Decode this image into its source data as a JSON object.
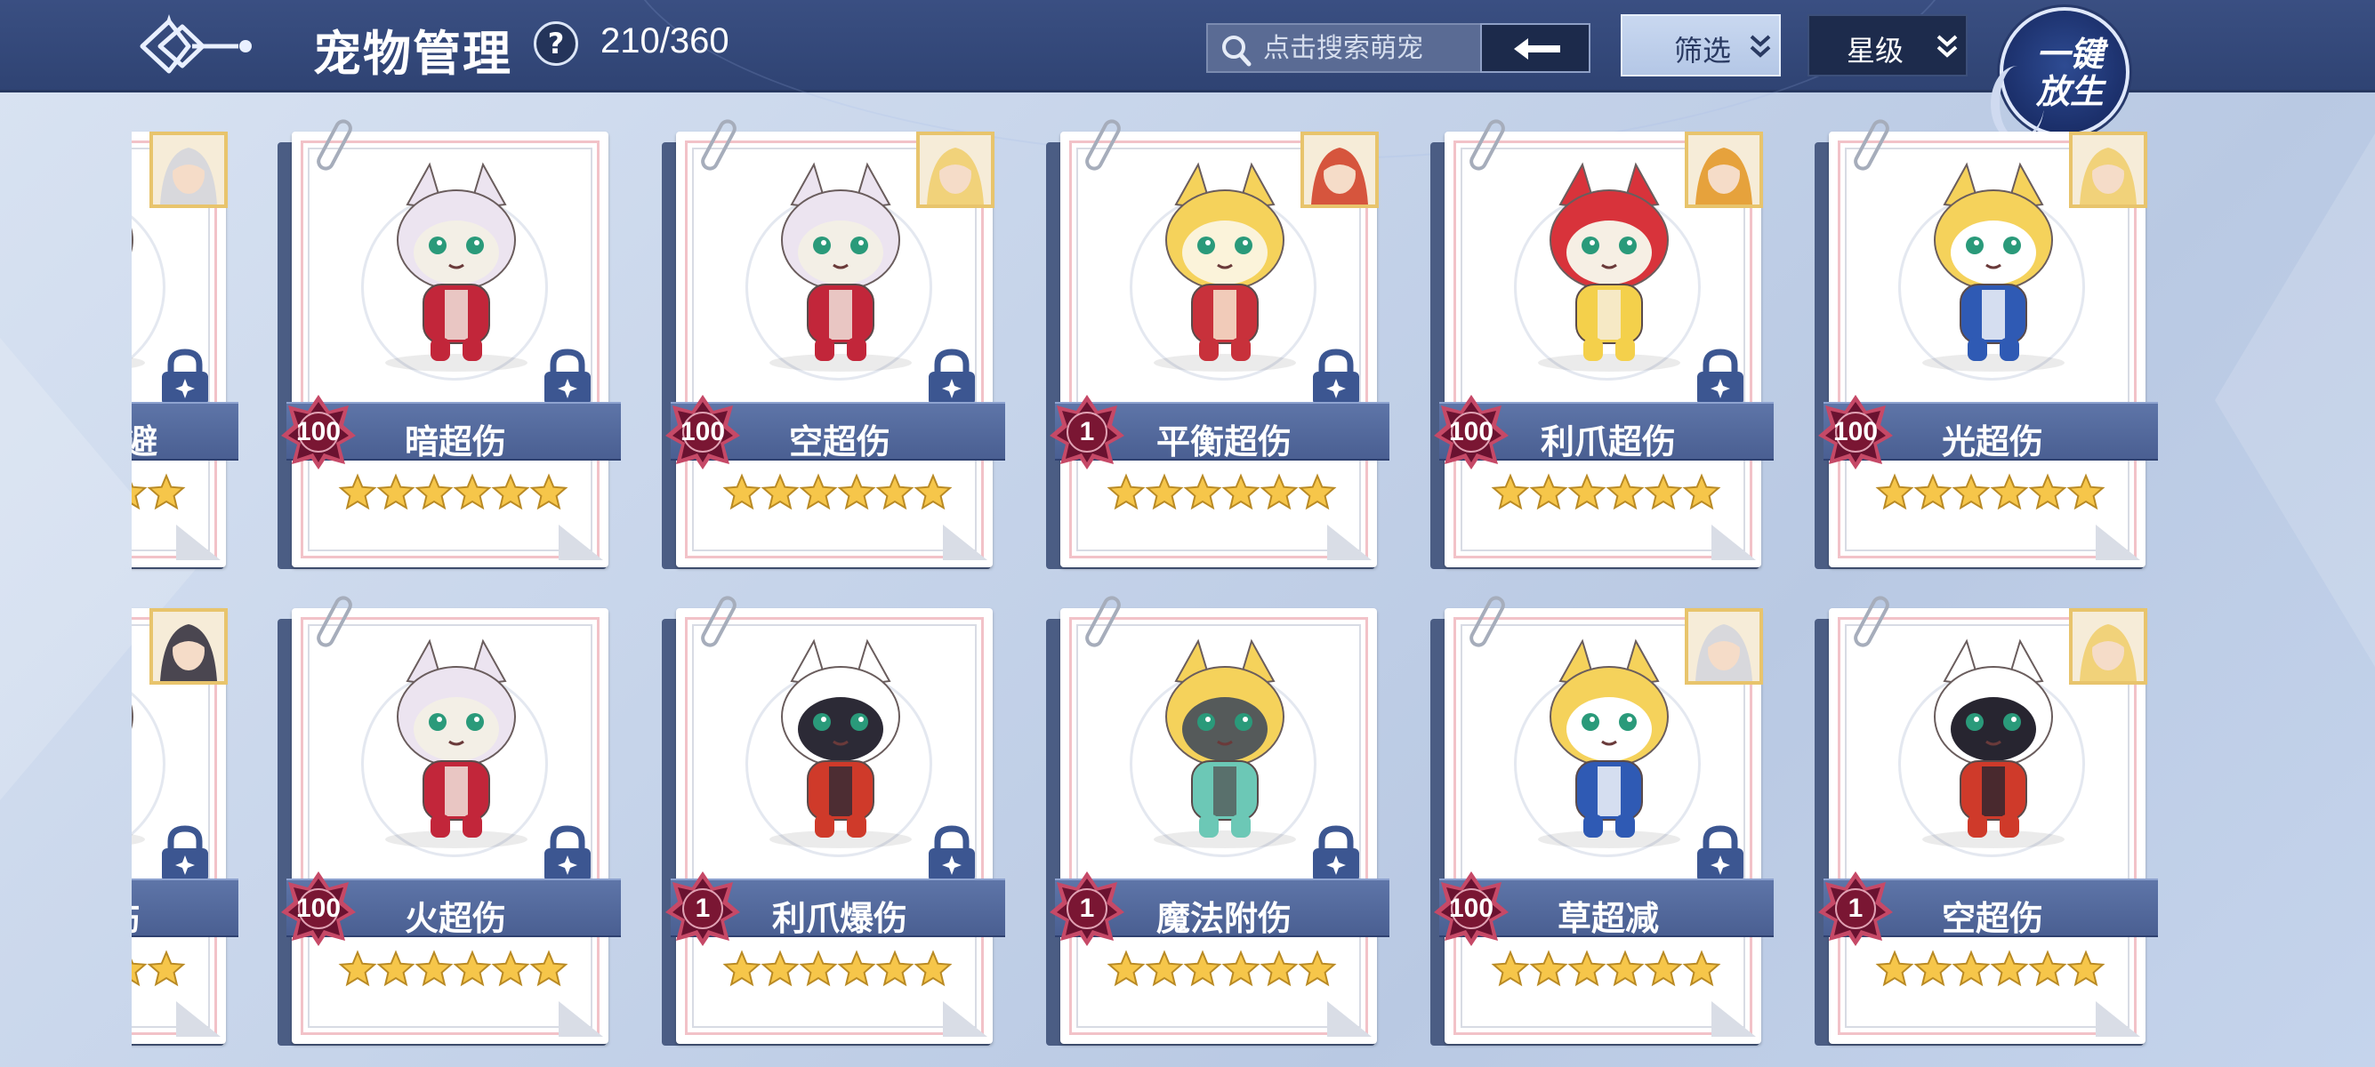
{
  "header": {
    "title": "宠物管理",
    "help": "?",
    "count": "210/360",
    "search_placeholder": "点击搜索萌宠",
    "filter_label": "筛选",
    "star_label": "星级",
    "release_line1": "一键",
    "release_line2": "放生"
  },
  "colors": {
    "header_bg": "#33477a",
    "band": "#5e75a8",
    "level_badge": "#7a1633",
    "star": "#f6c64a",
    "lock": "#3c5691"
  },
  "pets": [
    {
      "name": "大天使闪避",
      "level": "",
      "stars": 6,
      "locked": true,
      "portrait": true,
      "sprite": "green-dino",
      "portrait_theme": "silver"
    },
    {
      "name": "暗超伤",
      "level": "100",
      "stars": 6,
      "locked": true,
      "portrait": false,
      "sprite": "white-fox"
    },
    {
      "name": "空超伤",
      "level": "100",
      "stars": 6,
      "locked": true,
      "portrait": true,
      "sprite": "white-fox",
      "portrait_theme": "gold"
    },
    {
      "name": "平衡超伤",
      "level": "1",
      "stars": 6,
      "locked": true,
      "portrait": true,
      "sprite": "gold-knight",
      "portrait_theme": "red"
    },
    {
      "name": "利爪超伤",
      "level": "100",
      "stars": 6,
      "locked": true,
      "portrait": true,
      "sprite": "red-dragon",
      "portrait_theme": "red-gold"
    },
    {
      "name": "光超伤",
      "level": "100",
      "stars": 6,
      "locked": false,
      "portrait": true,
      "sprite": "blue-cat",
      "portrait_theme": "gold"
    },
    {
      "name": "平衡附伤",
      "level": "",
      "stars": 6,
      "locked": true,
      "portrait": true,
      "sprite": "red-dragon",
      "portrait_theme": "dark"
    },
    {
      "name": "火超伤",
      "level": "100",
      "stars": 6,
      "locked": true,
      "portrait": false,
      "sprite": "white-fox"
    },
    {
      "name": "利爪爆伤",
      "level": "1",
      "stars": 6,
      "locked": true,
      "portrait": false,
      "sprite": "horn-mage"
    },
    {
      "name": "魔法附伤",
      "level": "1",
      "stars": 6,
      "locked": true,
      "portrait": false,
      "sprite": "green-cat"
    },
    {
      "name": "草超减",
      "level": "100",
      "stars": 6,
      "locked": true,
      "portrait": true,
      "sprite": "blue-cat",
      "portrait_theme": "silver"
    },
    {
      "name": "空超伤",
      "level": "1",
      "stars": 6,
      "locked": false,
      "portrait": true,
      "sprite": "horn-suit",
      "portrait_theme": "gold"
    }
  ]
}
